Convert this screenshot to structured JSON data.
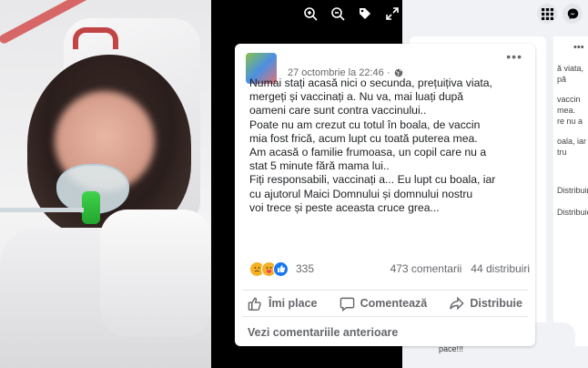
{
  "post": {
    "date": "27 octombrie la 22:46 ·",
    "more_label": "•••",
    "lines": [
      "Numai stați acasă nici o secunda, prețuițiva viata,",
      "mergeți și vaccinați a. Nu va, mai luați după",
      "oameni care sunt contra vaccinului..",
      "Poate nu am crezut cu totul în boala, de vaccin",
      "mia fost frică, acum lupt cu toată puterea mea.",
      "Am acasă o familie frumoasa, un copil care nu a",
      "stat 5 minute fără mama lui..",
      "Fiți responsabili, vaccinați a... Eu lupt cu boala, iar",
      "cu ajutorul Maici Domnului și domnului nostru",
      "voi trece și peste aceasta cruce grea..."
    ],
    "reactions_count": "335",
    "comments": "473 comentarii",
    "shares": "44 distribuiri",
    "like_label": "Îmi place",
    "comment_label": "Comentează",
    "share_label": "Distribuie",
    "previous_comments": "Vezi comentariile anterioare"
  },
  "side": {
    "fragments": [
      "ă viata,",
      "pă",
      "vaccin",
      "mea.",
      "re nu a",
      "oala, iar",
      "tru",
      "Distribuiri",
      "Distribuie"
    ],
    "pace": "pace!!!",
    "more_label": "•••"
  },
  "icons": [
    "zoom-in-icon",
    "zoom-out-icon",
    "tag-icon",
    "fullscreen-icon",
    "grid-icon",
    "messenger-icon",
    "globe-icon",
    "like-icon",
    "comment-icon",
    "share-icon"
  ]
}
